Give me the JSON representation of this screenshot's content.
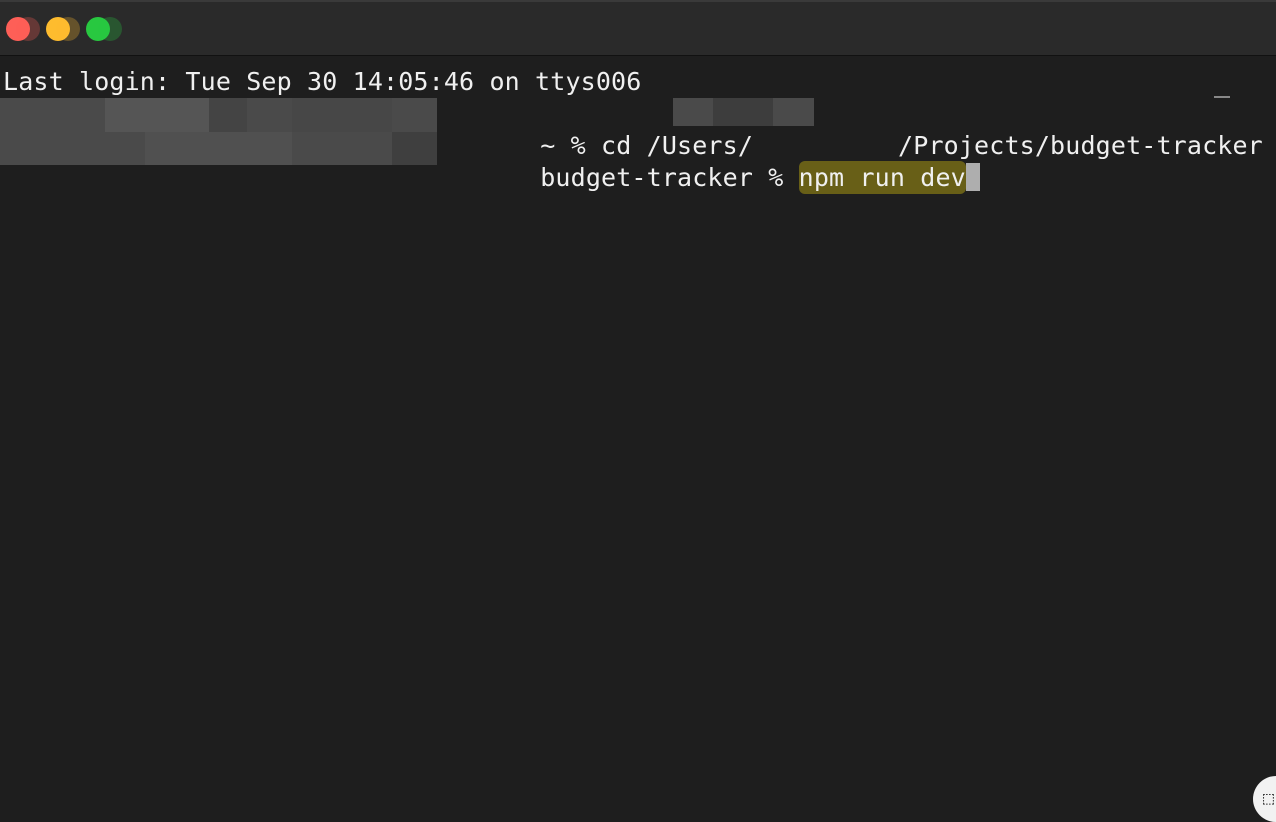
{
  "window": {
    "traffic_lights": [
      "close",
      "minimize",
      "zoom"
    ]
  },
  "terminal": {
    "line1": "Last login: Tue Sep 30 14:05:46 on ttys006",
    "line2_prefix": "~ % cd /Users/",
    "line2_suffix": "/Projects/budget-tracker",
    "line3_prompt": "budget-tracker % ",
    "line3_command": "npm run dev"
  },
  "corner_button": {
    "icon": "screenshot-icon"
  },
  "colors": {
    "background": "#1e1e1e",
    "titlebar": "#2a2a2a",
    "text": "#f0f0f0",
    "highlight": "#968714"
  }
}
